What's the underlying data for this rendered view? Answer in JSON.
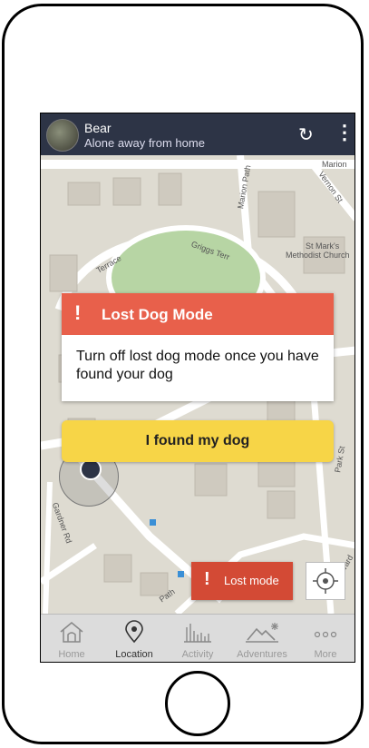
{
  "header": {
    "pet_name": "Bear",
    "pet_status": "Alone away from home",
    "refresh_icon": "refresh-icon",
    "menu_icon": "more-vertical-icon"
  },
  "map": {
    "labels": [
      "Marion",
      "Vernon St",
      "Marion Path",
      "Terrace",
      "Griggs Terr",
      "St Mark's",
      "Methodist Church",
      "Gardner Rd",
      "Park St",
      "Harvard",
      "Path"
    ]
  },
  "alert": {
    "title": "Lost Dog Mode",
    "message": "Turn off lost dog mode once you have found your dog",
    "icon": "!"
  },
  "found_button": {
    "label": "I found my dog"
  },
  "lost_mode_button": {
    "label": "Lost mode",
    "icon": "!"
  },
  "tabs": [
    {
      "label": "Home",
      "icon": "home-icon",
      "active": false
    },
    {
      "label": "Location",
      "icon": "location-pin-icon",
      "active": true
    },
    {
      "label": "Activity",
      "icon": "activity-bars-icon",
      "active": false
    },
    {
      "label": "Adventures",
      "icon": "mountain-icon",
      "active": false
    },
    {
      "label": "More",
      "icon": "more-dots-icon",
      "active": false
    }
  ],
  "colors": {
    "header_bg": "#2d3446",
    "alert_red": "#e8604b",
    "found_yellow": "#f7d547",
    "lost_mode_red": "#d34a35"
  }
}
